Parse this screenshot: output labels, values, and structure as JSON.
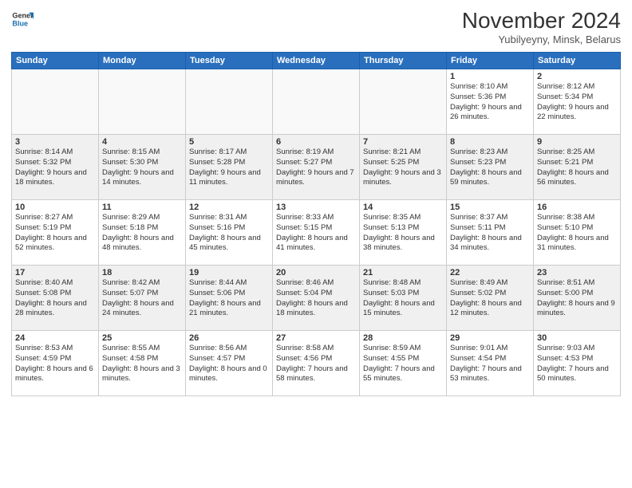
{
  "logo": {
    "line1": "General",
    "line2": "Blue"
  },
  "title": "November 2024",
  "subtitle": "Yubilyeyny, Minsk, Belarus",
  "headers": [
    "Sunday",
    "Monday",
    "Tuesday",
    "Wednesday",
    "Thursday",
    "Friday",
    "Saturday"
  ],
  "weeks": [
    [
      {
        "day": "",
        "info": ""
      },
      {
        "day": "",
        "info": ""
      },
      {
        "day": "",
        "info": ""
      },
      {
        "day": "",
        "info": ""
      },
      {
        "day": "",
        "info": ""
      },
      {
        "day": "1",
        "info": "Sunrise: 8:10 AM\nSunset: 5:36 PM\nDaylight: 9 hours and 26 minutes."
      },
      {
        "day": "2",
        "info": "Sunrise: 8:12 AM\nSunset: 5:34 PM\nDaylight: 9 hours and 22 minutes."
      }
    ],
    [
      {
        "day": "3",
        "info": "Sunrise: 8:14 AM\nSunset: 5:32 PM\nDaylight: 9 hours and 18 minutes."
      },
      {
        "day": "4",
        "info": "Sunrise: 8:15 AM\nSunset: 5:30 PM\nDaylight: 9 hours and 14 minutes."
      },
      {
        "day": "5",
        "info": "Sunrise: 8:17 AM\nSunset: 5:28 PM\nDaylight: 9 hours and 11 minutes."
      },
      {
        "day": "6",
        "info": "Sunrise: 8:19 AM\nSunset: 5:27 PM\nDaylight: 9 hours and 7 minutes."
      },
      {
        "day": "7",
        "info": "Sunrise: 8:21 AM\nSunset: 5:25 PM\nDaylight: 9 hours and 3 minutes."
      },
      {
        "day": "8",
        "info": "Sunrise: 8:23 AM\nSunset: 5:23 PM\nDaylight: 8 hours and 59 minutes."
      },
      {
        "day": "9",
        "info": "Sunrise: 8:25 AM\nSunset: 5:21 PM\nDaylight: 8 hours and 56 minutes."
      }
    ],
    [
      {
        "day": "10",
        "info": "Sunrise: 8:27 AM\nSunset: 5:19 PM\nDaylight: 8 hours and 52 minutes."
      },
      {
        "day": "11",
        "info": "Sunrise: 8:29 AM\nSunset: 5:18 PM\nDaylight: 8 hours and 48 minutes."
      },
      {
        "day": "12",
        "info": "Sunrise: 8:31 AM\nSunset: 5:16 PM\nDaylight: 8 hours and 45 minutes."
      },
      {
        "day": "13",
        "info": "Sunrise: 8:33 AM\nSunset: 5:15 PM\nDaylight: 8 hours and 41 minutes."
      },
      {
        "day": "14",
        "info": "Sunrise: 8:35 AM\nSunset: 5:13 PM\nDaylight: 8 hours and 38 minutes."
      },
      {
        "day": "15",
        "info": "Sunrise: 8:37 AM\nSunset: 5:11 PM\nDaylight: 8 hours and 34 minutes."
      },
      {
        "day": "16",
        "info": "Sunrise: 8:38 AM\nSunset: 5:10 PM\nDaylight: 8 hours and 31 minutes."
      }
    ],
    [
      {
        "day": "17",
        "info": "Sunrise: 8:40 AM\nSunset: 5:08 PM\nDaylight: 8 hours and 28 minutes."
      },
      {
        "day": "18",
        "info": "Sunrise: 8:42 AM\nSunset: 5:07 PM\nDaylight: 8 hours and 24 minutes."
      },
      {
        "day": "19",
        "info": "Sunrise: 8:44 AM\nSunset: 5:06 PM\nDaylight: 8 hours and 21 minutes."
      },
      {
        "day": "20",
        "info": "Sunrise: 8:46 AM\nSunset: 5:04 PM\nDaylight: 8 hours and 18 minutes."
      },
      {
        "day": "21",
        "info": "Sunrise: 8:48 AM\nSunset: 5:03 PM\nDaylight: 8 hours and 15 minutes."
      },
      {
        "day": "22",
        "info": "Sunrise: 8:49 AM\nSunset: 5:02 PM\nDaylight: 8 hours and 12 minutes."
      },
      {
        "day": "23",
        "info": "Sunrise: 8:51 AM\nSunset: 5:00 PM\nDaylight: 8 hours and 9 minutes."
      }
    ],
    [
      {
        "day": "24",
        "info": "Sunrise: 8:53 AM\nSunset: 4:59 PM\nDaylight: 8 hours and 6 minutes."
      },
      {
        "day": "25",
        "info": "Sunrise: 8:55 AM\nSunset: 4:58 PM\nDaylight: 8 hours and 3 minutes."
      },
      {
        "day": "26",
        "info": "Sunrise: 8:56 AM\nSunset: 4:57 PM\nDaylight: 8 hours and 0 minutes."
      },
      {
        "day": "27",
        "info": "Sunrise: 8:58 AM\nSunset: 4:56 PM\nDaylight: 7 hours and 58 minutes."
      },
      {
        "day": "28",
        "info": "Sunrise: 8:59 AM\nSunset: 4:55 PM\nDaylight: 7 hours and 55 minutes."
      },
      {
        "day": "29",
        "info": "Sunrise: 9:01 AM\nSunset: 4:54 PM\nDaylight: 7 hours and 53 minutes."
      },
      {
        "day": "30",
        "info": "Sunrise: 9:03 AM\nSunset: 4:53 PM\nDaylight: 7 hours and 50 minutes."
      }
    ]
  ]
}
